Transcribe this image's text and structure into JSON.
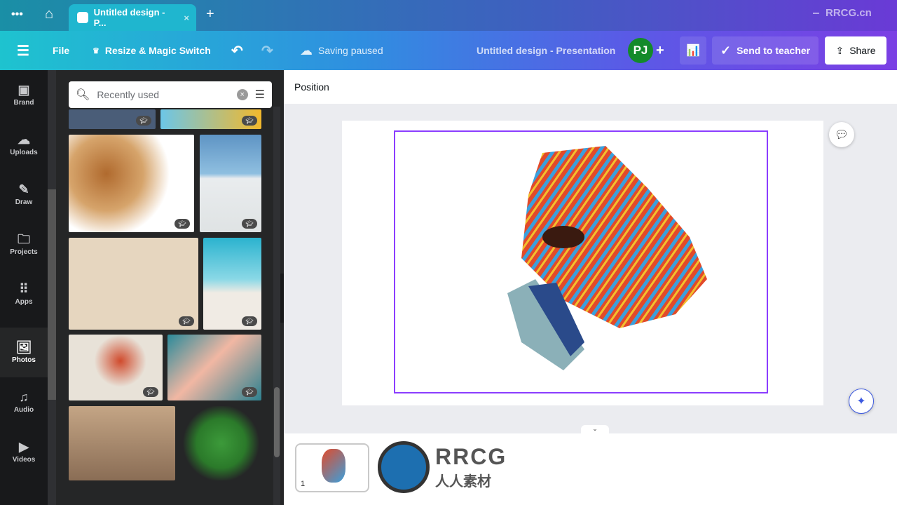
{
  "tabbar": {
    "tab_title": "Untitled design - P...",
    "window_watermark": "RRCG.cn"
  },
  "toolbar": {
    "file": "File",
    "resize": "Resize & Magic Switch",
    "saving_status": "Saving paused",
    "doc_title": "Untitled design - Presentation",
    "avatar_initials": "PJ",
    "send_to_teacher": "Send to teacher",
    "share": "Share"
  },
  "colors": {
    "accent": "#8b3dff",
    "avatar": "#138a2a"
  },
  "rail": {
    "items": [
      {
        "label": "Brand",
        "icon": "brand-icon"
      },
      {
        "label": "Uploads",
        "icon": "cloud-upload-icon"
      },
      {
        "label": "Draw",
        "icon": "pen-icon"
      },
      {
        "label": "Projects",
        "icon": "folder-icon"
      },
      {
        "label": "Apps",
        "icon": "grid-icon"
      },
      {
        "label": "Photos",
        "icon": "image-icon",
        "active": true
      },
      {
        "label": "Audio",
        "icon": "music-icon"
      },
      {
        "label": "Videos",
        "icon": "video-icon"
      }
    ]
  },
  "panel": {
    "search_value": "Recently used"
  },
  "context": {
    "position": "Position"
  },
  "footer": {
    "page_number": "1",
    "watermark_text": "RRCG",
    "watermark_sub": "人人素材"
  }
}
